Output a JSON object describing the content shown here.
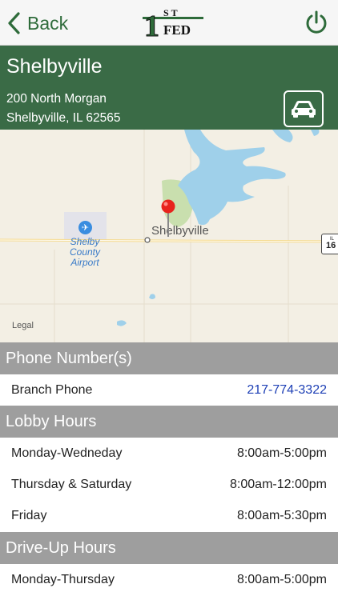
{
  "nav": {
    "back_label": "Back",
    "logo_top": "ST",
    "logo_one": "1",
    "logo_bottom": "FED"
  },
  "branch": {
    "name": "Shelbyville",
    "address_line1": "200 North Morgan",
    "address_line2": "Shelbyville, IL 62565"
  },
  "map": {
    "town_label": "Shelbyville",
    "airport_label": "Shelby County Airport",
    "legal_label": "Legal",
    "route_shield_state": "IL",
    "route_shield_number": "16"
  },
  "sections": {
    "phone": {
      "title": "Phone Number(s)",
      "rows": [
        {
          "label": "Branch Phone",
          "value": "217-774-3322"
        }
      ]
    },
    "lobby": {
      "title": "Lobby Hours",
      "rows": [
        {
          "label": "Monday-Wedneday",
          "value": "8:00am-5:00pm"
        },
        {
          "label": "Thursday & Saturday",
          "value": "8:00am-12:00pm"
        },
        {
          "label": "Friday",
          "value": "8:00am-5:30pm"
        }
      ]
    },
    "driveup": {
      "title": "Drive-Up Hours",
      "rows": [
        {
          "label": "Monday-Thursday",
          "value": "8:00am-5:00pm"
        }
      ]
    }
  },
  "colors": {
    "brand_green": "#3a6b46",
    "section_gray": "#9e9e9e",
    "link_blue": "#1d3fb5"
  }
}
